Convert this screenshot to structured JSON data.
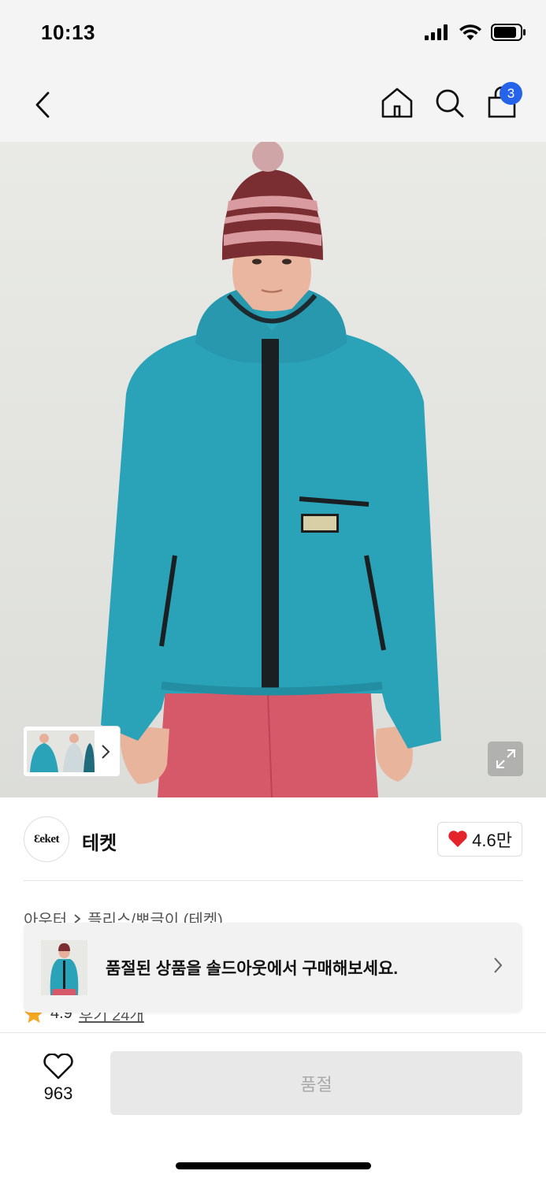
{
  "status_bar": {
    "time": "10:13"
  },
  "nav": {
    "cart_count": "3"
  },
  "brand": {
    "logo_text": "Ɛeket",
    "name": "테켓",
    "likes": "4.6만"
  },
  "breadcrumb": {
    "category": "아우터",
    "subcategory": "플리스/뽀글이 (테켓)"
  },
  "rating": {
    "score": "4.9",
    "reviews": "후기 24개"
  },
  "toast": {
    "message": "품절된 상품을 솔드아웃에서 구매해보세요."
  },
  "bottom": {
    "wish_count": "963",
    "button_label": "품절"
  },
  "colors": {
    "accent_badge": "#2563eb",
    "heart": "#e5232b",
    "star": "#f5a623",
    "jacket": "#2aa3b8"
  }
}
